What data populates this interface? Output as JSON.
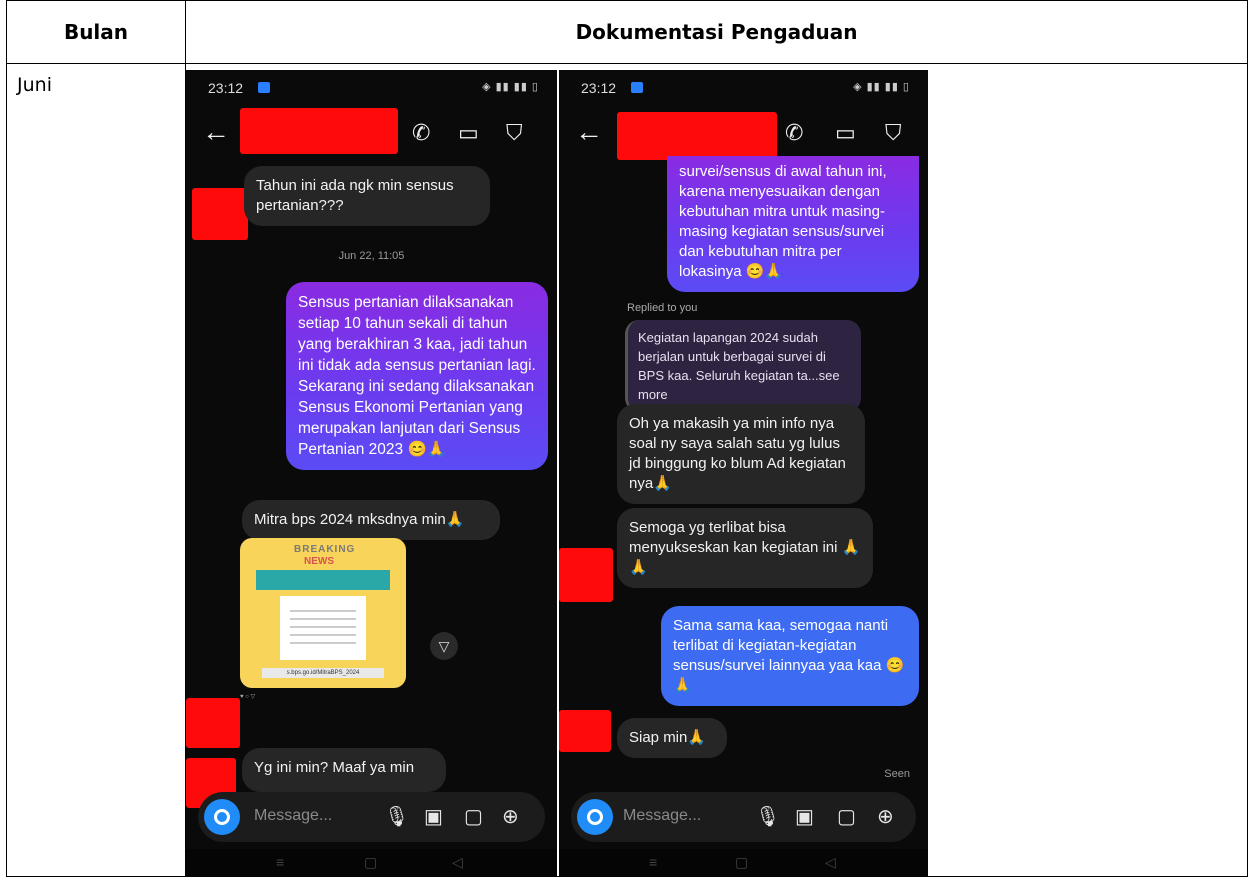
{
  "table": {
    "header_month": "Bulan",
    "header_doc": "Dokumentasi Pengaduan",
    "month": "Juni"
  },
  "phone_left": {
    "time": "23:12",
    "timestamp": "Jun 22, 11:05",
    "msg1": "Tahun ini ada ngk min sensus pertanian???",
    "msg2": "Sensus pertanian dilaksanakan setiap 10 tahun sekali di tahun yang berakhiran 3 kaa, jadi tahun ini tidak ada sensus pertanian lagi. Sekarang ini sedang dilaksanakan Sensus Ekonomi Pertanian yang merupakan lanjutan dari Sensus Pertanian 2023 😊🙏",
    "msg3": "Mitra bps 2024 mksdnya min🙏",
    "post_breaking": "BREAKING",
    "post_news": "NEWS",
    "post_link": "s.bps.go.id/MitraBPS_2024",
    "msg4": "Yg ini min? Maaf ya min",
    "placeholder": "Message..."
  },
  "phone_right": {
    "time": "23:12",
    "msg_top": "survei/sensus di awal tahun ini, karena menyesuaikan dengan kebutuhan mitra untuk masing-masing kegiatan sensus/survei dan kebutuhan mitra per lokasinya 😊🙏",
    "reply_label": "Replied to you",
    "quote": "Kegiatan lapangan 2024 sudah berjalan untuk berbagai survei di BPS kaa. Seluruh kegiatan ta...see more",
    "msg1": "Oh ya makasih ya min info nya soal ny saya salah satu yg lulus jd binggung ko blum Ad kegiatan nya🙏",
    "msg2": "Semoga yg terlibat bisa menyukseskan kan kegiatan ini 🙏🙏",
    "msg3": "Sama sama kaa, semogaa nanti terlibat di kegiatan-kegiatan sensus/survei lainnyaa yaa kaa 😊🙏",
    "msg4": "Siap min🙏",
    "seen": "Seen",
    "placeholder": "Message..."
  }
}
